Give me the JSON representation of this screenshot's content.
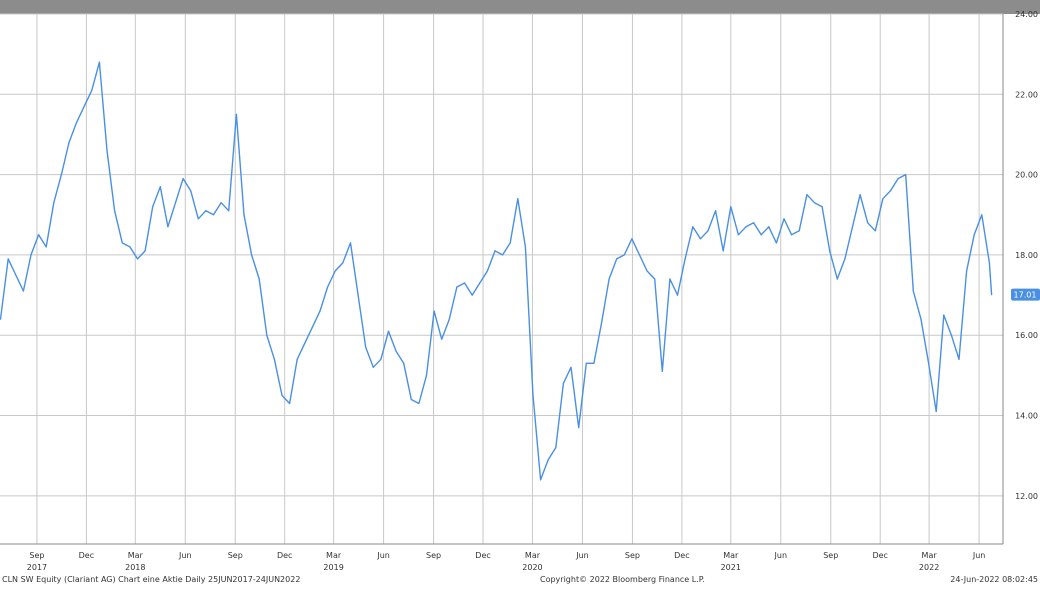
{
  "chart_data": {
    "type": "line",
    "title": "",
    "xlabel": "",
    "ylabel": "",
    "ylim": [
      10.8,
      24.0
    ],
    "y_ticks": [
      "12.00",
      "14.00",
      "16.00",
      "18.00",
      "20.00",
      "22.00",
      "24.00"
    ],
    "y_tick_values": [
      12,
      14,
      16,
      18,
      20,
      22,
      24
    ],
    "x_month_ticks": [
      "Sep",
      "Dec",
      "Mar",
      "Jun",
      "Sep",
      "Dec",
      "Mar",
      "Jun",
      "Sep",
      "Dec",
      "Mar",
      "Jun",
      "Sep",
      "Dec",
      "Mar",
      "Jun",
      "Sep",
      "Dec",
      "Mar",
      "Jun"
    ],
    "x_years": [
      "2017",
      "2018",
      "2019",
      "2020",
      "2021",
      "2022"
    ],
    "last_value_label": "17.01",
    "grid": true,
    "series": [
      {
        "color": "#4a90e2",
        "x": [
          "2017-06-26",
          "2017-07-10",
          "2017-07-24",
          "2017-08-07",
          "2017-08-21",
          "2017-09-04",
          "2017-09-18",
          "2017-10-02",
          "2017-10-16",
          "2017-10-30",
          "2017-11-13",
          "2017-11-27",
          "2017-12-11",
          "2017-12-25",
          "2018-01-08",
          "2018-01-22",
          "2018-02-05",
          "2018-02-19",
          "2018-03-05",
          "2018-03-19",
          "2018-04-02",
          "2018-04-16",
          "2018-04-30",
          "2018-05-14",
          "2018-05-28",
          "2018-06-11",
          "2018-06-25",
          "2018-07-09",
          "2018-07-23",
          "2018-08-06",
          "2018-08-20",
          "2018-09-03",
          "2018-09-17",
          "2018-10-01",
          "2018-10-15",
          "2018-10-29",
          "2018-11-12",
          "2018-11-26",
          "2018-12-10",
          "2018-12-24",
          "2019-01-07",
          "2019-01-21",
          "2019-02-04",
          "2019-02-18",
          "2019-03-04",
          "2019-03-18",
          "2019-04-01",
          "2019-04-15",
          "2019-04-29",
          "2019-05-13",
          "2019-05-27",
          "2019-06-10",
          "2019-06-24",
          "2019-07-08",
          "2019-07-22",
          "2019-08-05",
          "2019-08-19",
          "2019-09-02",
          "2019-09-16",
          "2019-09-30",
          "2019-10-14",
          "2019-10-28",
          "2019-11-11",
          "2019-11-25",
          "2019-12-09",
          "2019-12-23",
          "2020-01-06",
          "2020-01-20",
          "2020-02-03",
          "2020-02-17",
          "2020-03-02",
          "2020-03-16",
          "2020-03-30",
          "2020-04-13",
          "2020-04-27",
          "2020-05-11",
          "2020-05-25",
          "2020-06-08",
          "2020-06-22",
          "2020-07-06",
          "2020-07-20",
          "2020-08-03",
          "2020-08-17",
          "2020-08-31",
          "2020-09-14",
          "2020-09-28",
          "2020-10-12",
          "2020-10-26",
          "2020-11-09",
          "2020-11-23",
          "2020-12-07",
          "2020-12-21",
          "2021-01-04",
          "2021-01-18",
          "2021-02-01",
          "2021-02-15",
          "2021-03-01",
          "2021-03-15",
          "2021-03-29",
          "2021-04-12",
          "2021-04-26",
          "2021-05-10",
          "2021-05-24",
          "2021-06-07",
          "2021-06-21",
          "2021-07-05",
          "2021-07-19",
          "2021-08-02",
          "2021-08-16",
          "2021-08-30",
          "2021-09-13",
          "2021-09-27",
          "2021-10-11",
          "2021-10-25",
          "2021-11-08",
          "2021-11-22",
          "2021-12-06",
          "2021-12-20",
          "2022-01-03",
          "2022-01-17",
          "2022-01-31",
          "2022-02-14",
          "2022-02-28",
          "2022-03-14",
          "2022-03-28",
          "2022-04-11",
          "2022-04-25",
          "2022-05-09",
          "2022-05-23",
          "2022-06-06",
          "2022-06-20",
          "2022-06-24"
        ],
        "values": [
          16.4,
          17.9,
          17.5,
          17.1,
          18.0,
          18.5,
          18.2,
          19.3,
          20.0,
          20.8,
          21.3,
          21.7,
          22.1,
          22.8,
          20.6,
          19.1,
          18.3,
          18.2,
          17.9,
          18.1,
          19.2,
          19.7,
          18.7,
          19.3,
          19.9,
          19.6,
          18.9,
          19.1,
          19.0,
          19.3,
          19.1,
          21.5,
          19.0,
          18.0,
          17.4,
          16.0,
          15.4,
          14.5,
          14.3,
          15.4,
          15.8,
          16.2,
          16.6,
          17.2,
          17.6,
          17.8,
          18.3,
          17.0,
          15.7,
          15.2,
          15.4,
          16.1,
          15.6,
          15.3,
          14.4,
          14.3,
          15.0,
          16.6,
          15.9,
          16.4,
          17.2,
          17.3,
          17.0,
          17.3,
          17.6,
          18.1,
          18.0,
          18.3,
          19.4,
          18.2,
          14.5,
          12.4,
          12.9,
          13.2,
          14.8,
          15.2,
          13.7,
          15.3,
          15.3,
          16.3,
          17.4,
          17.9,
          18.0,
          18.4,
          18.0,
          17.6,
          17.4,
          15.1,
          17.4,
          17.0,
          17.9,
          18.7,
          18.4,
          18.6,
          19.1,
          18.1,
          19.2,
          18.5,
          18.7,
          18.8,
          18.5,
          18.7,
          18.3,
          18.9,
          18.5,
          18.6,
          19.5,
          19.3,
          19.2,
          18.1,
          17.4,
          17.9,
          18.7,
          19.5,
          18.8,
          18.6,
          19.4,
          19.6,
          19.9,
          20.0,
          17.1,
          16.4,
          15.3,
          14.1,
          16.5,
          16.0,
          15.4,
          17.6,
          18.5,
          19.0,
          17.8,
          17.01
        ]
      }
    ]
  },
  "footer": {
    "left": "CLN SW Equity (Clariant AG) Chart eine Aktie   Daily 25JUN2017-24JUN2022",
    "center": "Copyright© 2022 Bloomberg Finance L.P.",
    "right": "24-Jun-2022 08:02:45"
  },
  "colors": {
    "top_bar": "#8c8c8c",
    "grid": "#c8c8c8",
    "line": "#4a90e2",
    "last_label_bg": "#4a90e2"
  }
}
